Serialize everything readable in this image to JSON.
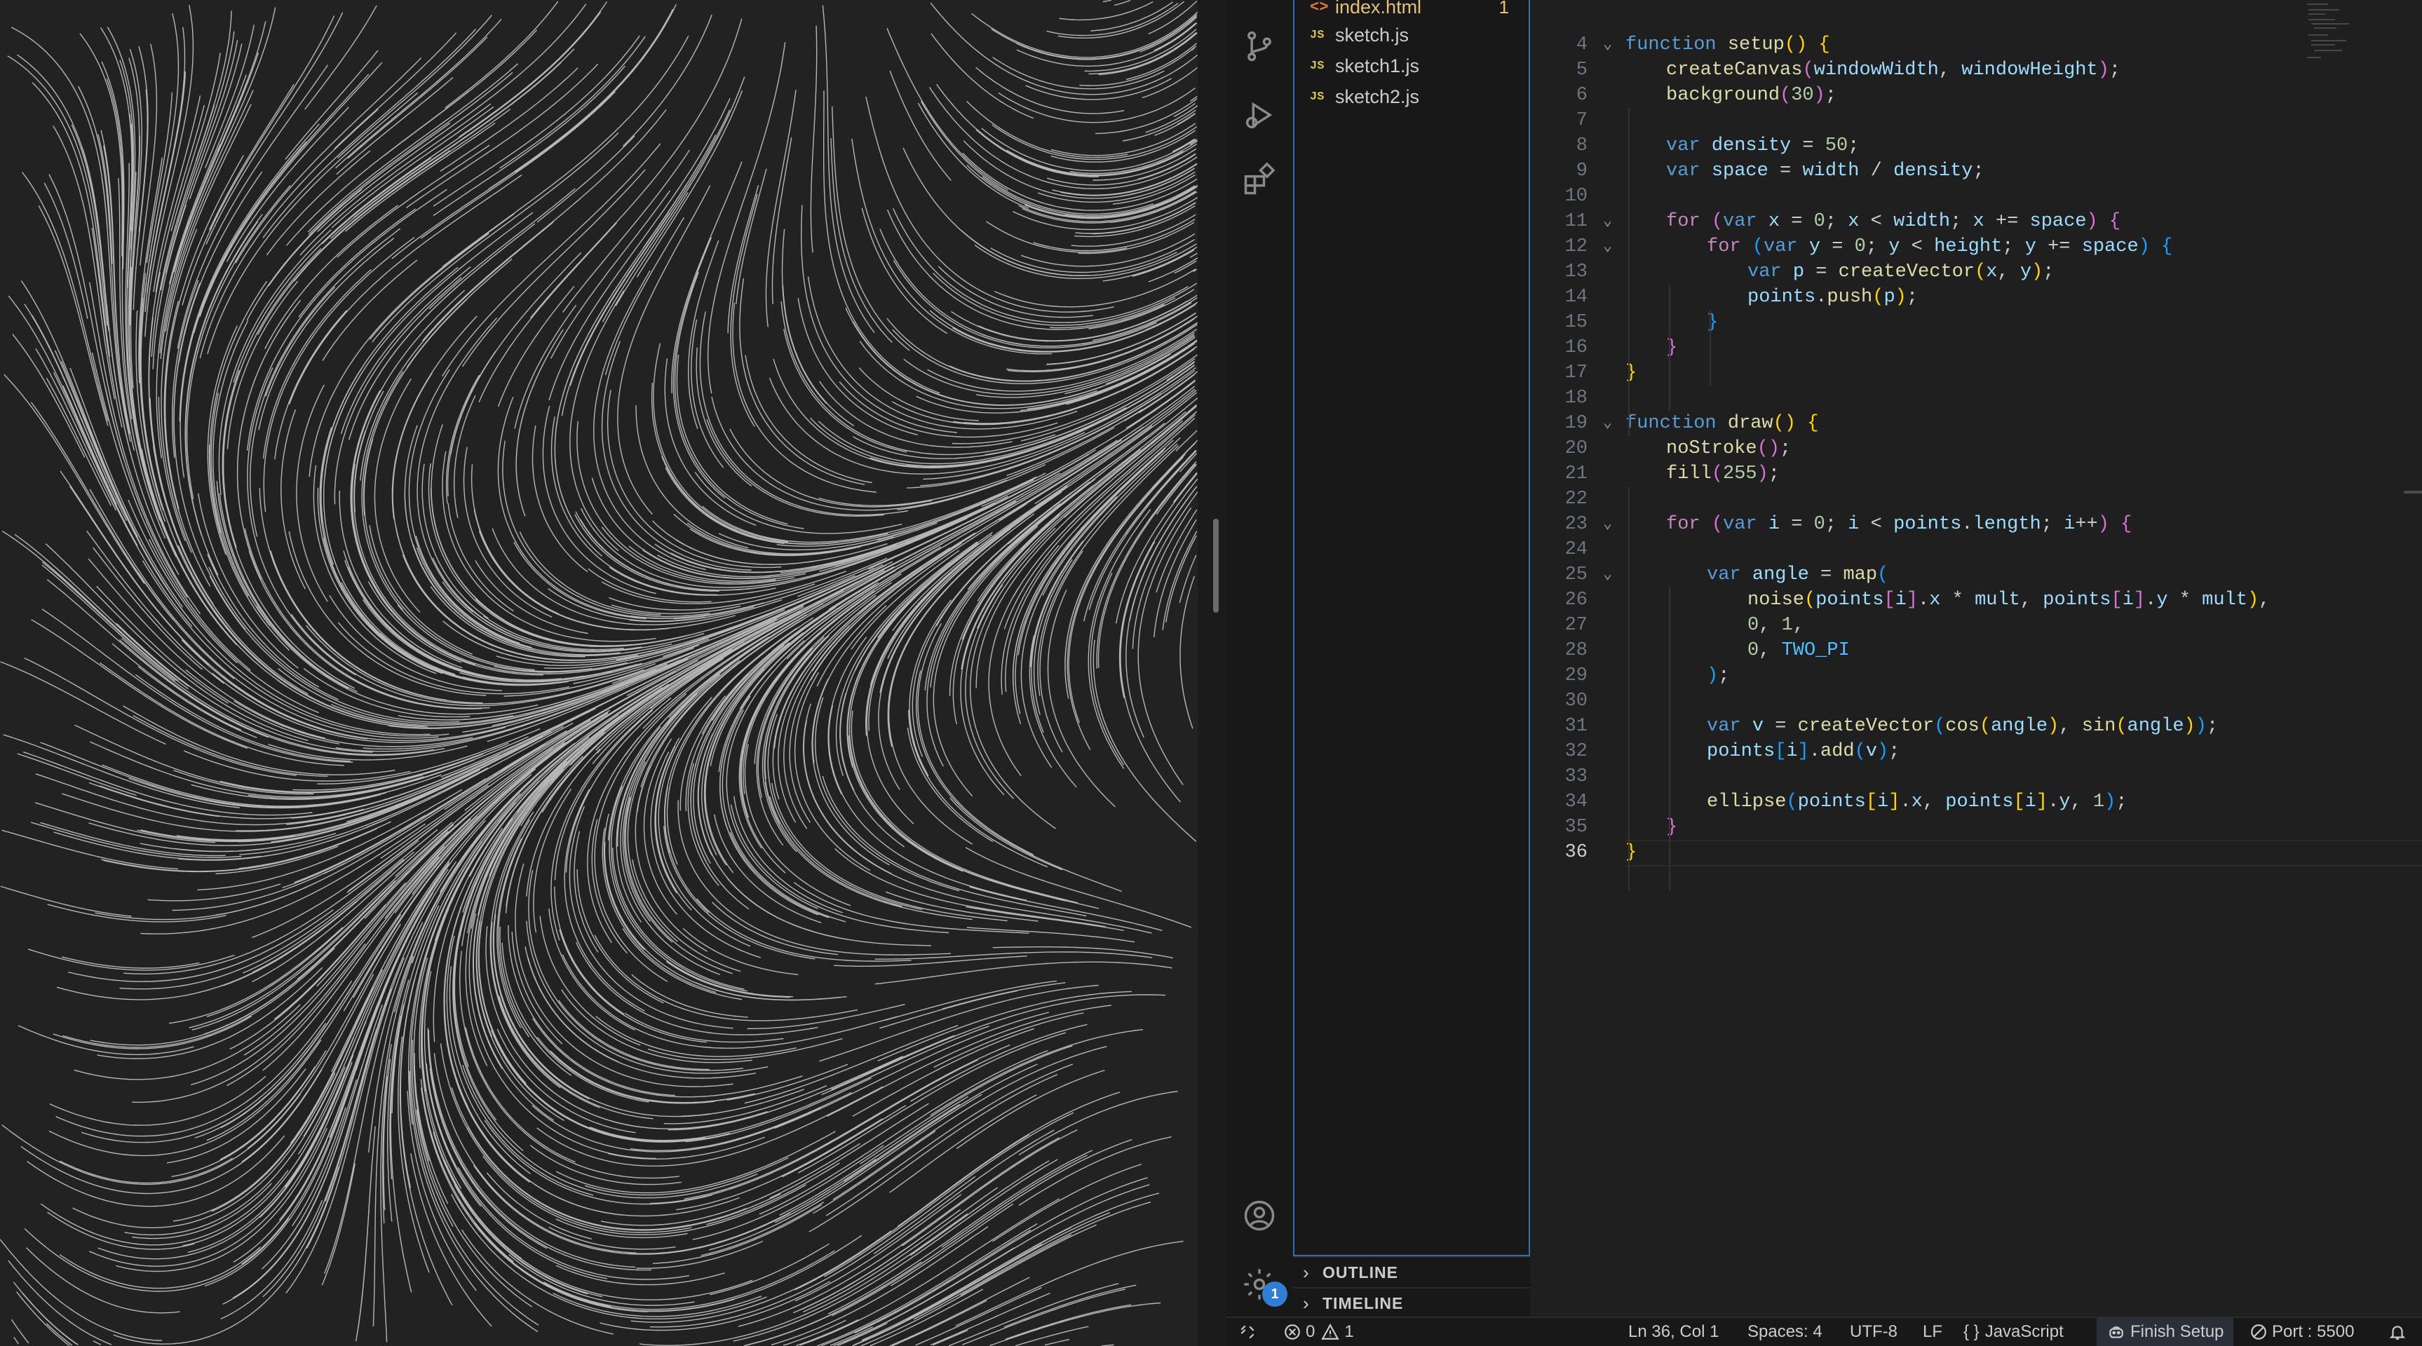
{
  "explorer": {
    "files": [
      {
        "name": "index.html",
        "icon": "html-file-icon",
        "type_glyph": "<>",
        "badge": "1",
        "modified": true
      },
      {
        "name": "sketch.js",
        "icon": "js-file-icon",
        "type_glyph": "JS"
      },
      {
        "name": "sketch1.js",
        "icon": "js-file-icon",
        "type_glyph": "JS"
      },
      {
        "name": "sketch2.js",
        "icon": "js-file-icon",
        "type_glyph": "JS"
      }
    ],
    "sections": [
      {
        "label": "OUTLINE"
      },
      {
        "label": "TIMELINE"
      }
    ]
  },
  "activity_bar": {
    "icons": [
      "source-control-icon",
      "run-debug-icon",
      "extensions-icon",
      "account-icon",
      "settings-icon"
    ],
    "settings_badge": "1"
  },
  "editor": {
    "current_line": 36,
    "lines": [
      {
        "n": 4,
        "fold": true,
        "html": "<span class='kw'>function</span> <span class='fn'>setup</span><span class='b1'>()</span> <span class='b1'>{</span>"
      },
      {
        "n": 5,
        "indent": 1,
        "html": "<span class='fn'>createCanvas</span><span class='b2'>(</span><span class='vr'>windowWidth</span>, <span class='vr'>windowHeight</span><span class='b2'>)</span>;"
      },
      {
        "n": 6,
        "indent": 1,
        "html": "<span class='fn'>background</span><span class='b2'>(</span><span class='nm'>30</span><span class='b2'>)</span>;"
      },
      {
        "n": 7,
        "html": ""
      },
      {
        "n": 8,
        "indent": 1,
        "html": "<span class='kw'>var</span> <span class='vr'>density</span> = <span class='nm'>50</span>;"
      },
      {
        "n": 9,
        "indent": 1,
        "html": "<span class='kw'>var</span> <span class='vr'>space</span> = <span class='vr'>width</span> / <span class='vr'>density</span>;"
      },
      {
        "n": 10,
        "html": ""
      },
      {
        "n": 11,
        "fold": true,
        "indent": 1,
        "html": "<span class='kw2'>for</span> <span class='b2'>(</span><span class='kw'>var</span> <span class='vr'>x</span> = <span class='nm'>0</span>; <span class='vr'>x</span> &lt; <span class='vr'>width</span>; <span class='vr'>x</span> += <span class='vr'>space</span><span class='b2'>)</span> <span class='b2'>{</span>"
      },
      {
        "n": 12,
        "fold": true,
        "indent": 2,
        "html": "<span class='kw2'>for</span> <span class='b3'>(</span><span class='kw'>var</span> <span class='vr'>y</span> = <span class='nm'>0</span>; <span class='vr'>y</span> &lt; <span class='vr'>height</span>; <span class='vr'>y</span> += <span class='vr'>space</span><span class='b3'>)</span> <span class='b3'>{</span>"
      },
      {
        "n": 13,
        "indent": 3,
        "html": "<span class='kw'>var</span> <span class='vr'>p</span> = <span class='fn'>createVector</span><span class='b1'>(</span><span class='vr'>x</span>, <span class='vr'>y</span><span class='b1'>)</span>;"
      },
      {
        "n": 14,
        "indent": 3,
        "html": "<span class='vr'>points</span>.<span class='fn'>push</span><span class='b1'>(</span><span class='vr'>p</span><span class='b1'>)</span>;"
      },
      {
        "n": 15,
        "indent": 2,
        "html": "<span class='b3'>}</span>"
      },
      {
        "n": 16,
        "indent": 1,
        "html": "<span class='b2'>}</span>"
      },
      {
        "n": 17,
        "html": "<span class='b1'>}</span>"
      },
      {
        "n": 18,
        "html": ""
      },
      {
        "n": 19,
        "fold": true,
        "html": "<span class='kw'>function</span> <span class='fn'>draw</span><span class='b1'>()</span> <span class='b1'>{</span>"
      },
      {
        "n": 20,
        "indent": 1,
        "html": "<span class='fn'>noStroke</span><span class='b2'>()</span>;"
      },
      {
        "n": 21,
        "indent": 1,
        "html": "<span class='fn'>fill</span><span class='b2'>(</span><span class='nm'>255</span><span class='b2'>)</span>;"
      },
      {
        "n": 22,
        "html": ""
      },
      {
        "n": 23,
        "fold": true,
        "indent": 1,
        "html": "<span class='kw2'>for</span> <span class='b2'>(</span><span class='kw'>var</span> <span class='vr'>i</span> = <span class='nm'>0</span>; <span class='vr'>i</span> &lt; <span class='vr'>points</span>.<span class='vr'>length</span>; <span class='vr'>i</span>++<span class='b2'>)</span> <span class='b2'>{</span>"
      },
      {
        "n": 24,
        "html": ""
      },
      {
        "n": 25,
        "fold": true,
        "indent": 2,
        "html": "<span class='kw'>var</span> <span class='vr'>angle</span> = <span class='fn'>map</span><span class='b3'>(</span>"
      },
      {
        "n": 26,
        "indent": 3,
        "html": "<span class='fn'>noise</span><span class='b1'>(</span><span class='vr'>points</span><span class='b2'>[</span><span class='vr'>i</span><span class='b2'>]</span>.<span class='vr'>x</span> * <span class='vr'>mult</span>, <span class='vr'>points</span><span class='b2'>[</span><span class='vr'>i</span><span class='b2'>]</span>.<span class='vr'>y</span> * <span class='vr'>mult</span><span class='b1'>)</span>,"
      },
      {
        "n": 27,
        "indent": 3,
        "html": "<span class='nm'>0</span>, <span class='nm'>1</span>,"
      },
      {
        "n": 28,
        "indent": 3,
        "html": "<span class='nm'>0</span>, <span class='cst'>TWO_PI</span>"
      },
      {
        "n": 29,
        "indent": 2,
        "html": "<span class='b3'>)</span>;"
      },
      {
        "n": 30,
        "html": ""
      },
      {
        "n": 31,
        "indent": 2,
        "html": "<span class='kw'>var</span> <span class='vr'>v</span> = <span class='fn'>createVector</span><span class='b3'>(</span><span class='fn'>cos</span><span class='b1'>(</span><span class='vr'>angle</span><span class='b1'>)</span>, <span class='fn'>sin</span><span class='b1'>(</span><span class='vr'>angle</span><span class='b1'>)</span><span class='b3'>)</span>;"
      },
      {
        "n": 32,
        "indent": 2,
        "html": "<span class='vr'>points</span><span class='b3'>[</span><span class='vr'>i</span><span class='b3'>]</span>.<span class='fn'>add</span><span class='b3'>(</span><span class='vr'>v</span><span class='b3'>)</span>;"
      },
      {
        "n": 33,
        "html": ""
      },
      {
        "n": 34,
        "indent": 2,
        "html": "<span class='fn'>ellipse</span><span class='b3'>(</span><span class='vr'>points</span><span class='b1'>[</span><span class='vr'>i</span><span class='b1'>]</span>.<span class='vr'>x</span>, <span class='vr'>points</span><span class='b1'>[</span><span class='vr'>i</span><span class='b1'>]</span>.<span class='vr'>y</span>, <span class='nm'>1</span><span class='b3'>)</span>;"
      },
      {
        "n": 35,
        "indent": 1,
        "html": "<span class='b2'>}</span>"
      },
      {
        "n": 36,
        "html": "<span class='b1'>}</span>"
      }
    ]
  },
  "status_bar": {
    "errors": "0",
    "warnings": "1",
    "position": "Ln 36, Col 1",
    "spaces": "Spaces: 4",
    "encoding": "UTF-8",
    "eol": "LF",
    "language_glyph": "{ }",
    "language": "JavaScript",
    "finish_setup": "Finish Setup",
    "port": "Port : 5500"
  }
}
